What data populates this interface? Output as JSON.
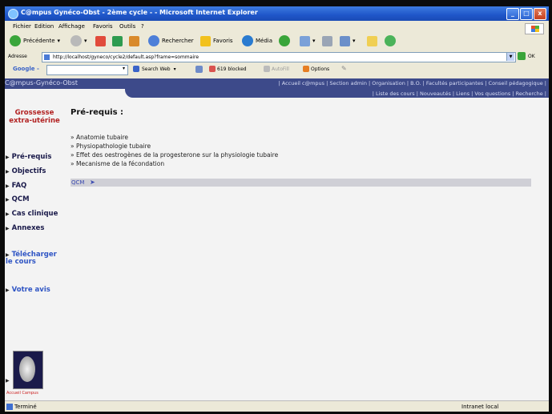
{
  "window": {
    "title": "C@mpus Gynéco-Obst - 2ème cycle - - Microsoft Internet Explorer",
    "controls": {
      "min": "_",
      "max": "□",
      "close": "x"
    }
  },
  "menu": [
    "Fichier",
    "Edition",
    "Affichage",
    "Favoris",
    "Outils",
    "?"
  ],
  "toolbar": {
    "back_label": "Précédente",
    "search_label": "Rechercher",
    "favorites_label": "Favoris",
    "media_label": "Média"
  },
  "address": {
    "label": "Adresse",
    "url": "http://localhost/gyneco/cycle2/default.asp?frame=sommaire",
    "go_label": "OK"
  },
  "googlebar": {
    "brand": "Google -",
    "search_web": "Search Web",
    "blocked": "619 blocked",
    "autofill": "AutoFill",
    "options": "Options"
  },
  "site": {
    "brand": "C@mpus-Gynéco-Obst",
    "top_links": "| Accueil c@mpus | Section admin | Organisation | B.O. | Facultés participantes | Conseil pédagogique |",
    "sub_links": "| Liste des cours | Nouveautés | Liens | Vos questions | Recherche |"
  },
  "sidebar": {
    "title": "Grossesse extra-utérine",
    "items": [
      "Pré-requis",
      "Objectifs",
      "FAQ",
      "QCM",
      "Cas clinique",
      "Annexes"
    ],
    "download": "Télécharger le cours",
    "feedback": "Votre avis",
    "logo_caption": "Accueil Campus"
  },
  "main": {
    "title": "Pré-requis :",
    "bullets": [
      "Anatomie tubaire",
      "Physiopathologie tubaire",
      "Effet des oestrogènes de la progesterone sur la physiologie tubaire",
      "Mecanisme de la fécondation"
    ],
    "next_link": "QCM"
  },
  "status": {
    "text": "Terminé",
    "zone": "Intranet local"
  },
  "colors": {
    "header_bg": "#3d4a8a",
    "title_red": "#b22222",
    "link_blue": "#2f55c4"
  }
}
